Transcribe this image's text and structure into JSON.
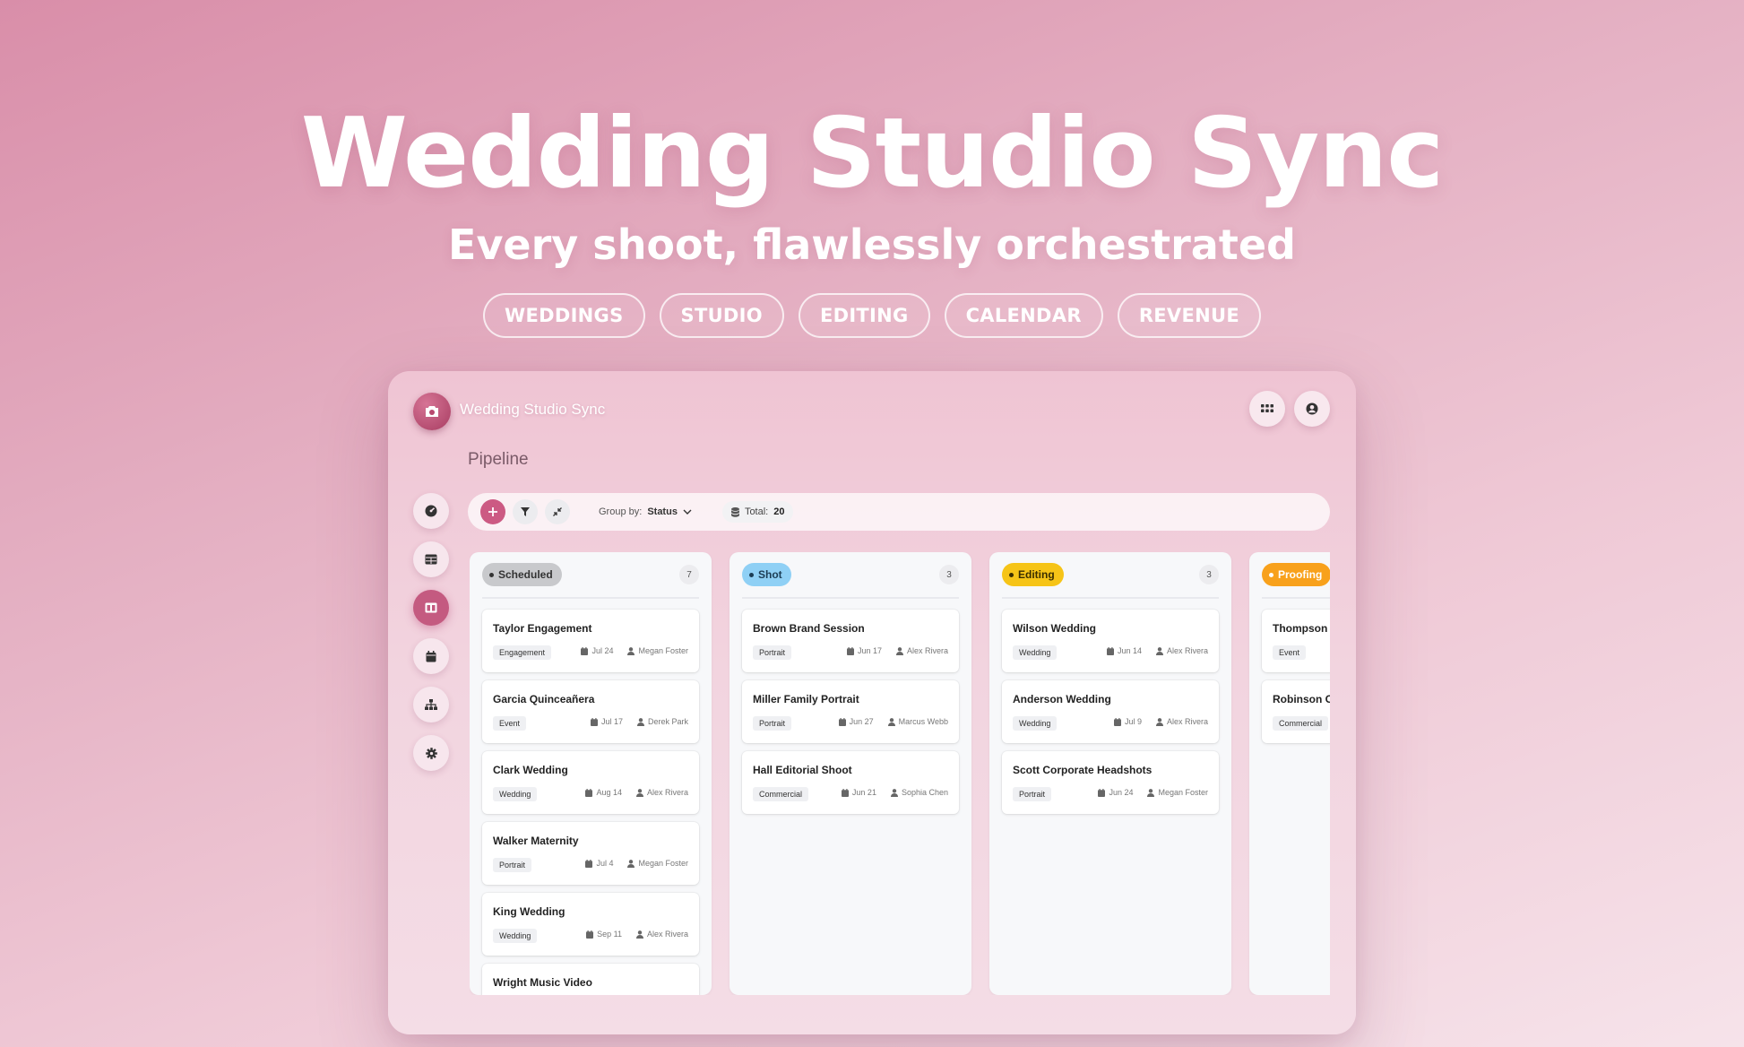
{
  "hero": {
    "title": "Wedding Studio Sync",
    "subtitle": "Every shoot, flawlessly orchestrated",
    "tags": [
      "WEDDINGS",
      "STUDIO",
      "EDITING",
      "CALENDAR",
      "REVENUE"
    ]
  },
  "app": {
    "name": "Wedding Studio Sync",
    "page_title": "Pipeline",
    "accent": "#c45a80",
    "sidebar_icons": [
      "dashboard-icon",
      "table-icon",
      "board-icon",
      "calendar-icon",
      "org-chart-icon",
      "settings-icon"
    ],
    "toolbar": {
      "group_by_label": "Group by:",
      "group_by_value": "Status",
      "total_label": "Total:",
      "total_value": "20"
    },
    "columns": [
      {
        "label": "Scheduled",
        "count": "7",
        "pill_bg": "#c8c9cc",
        "pill_fg": "#333333",
        "dot": "#333333",
        "cards": [
          {
            "title": "Taylor Engagement",
            "type": "Engagement",
            "date": "Jul 24",
            "person": "Megan Foster"
          },
          {
            "title": "Garcia Quinceañera",
            "type": "Event",
            "date": "Jul 17",
            "person": "Derek Park"
          },
          {
            "title": "Clark Wedding",
            "type": "Wedding",
            "date": "Aug 14",
            "person": "Alex Rivera"
          },
          {
            "title": "Walker Maternity",
            "type": "Portrait",
            "date": "Jul 4",
            "person": "Megan Foster"
          },
          {
            "title": "King Wedding",
            "type": "Wedding",
            "date": "Sep 11",
            "person": "Alex Rivera"
          },
          {
            "title": "Wright Music Video",
            "type": "",
            "date": "",
            "person": ""
          }
        ]
      },
      {
        "label": "Shot",
        "count": "3",
        "pill_bg": "#8fd0f5",
        "pill_fg": "#1c3d55",
        "dot": "#1c3d55",
        "cards": [
          {
            "title": "Brown Brand Session",
            "type": "Portrait",
            "date": "Jun 17",
            "person": "Alex Rivera"
          },
          {
            "title": "Miller Family Portrait",
            "type": "Portrait",
            "date": "Jun 27",
            "person": "Marcus Webb"
          },
          {
            "title": "Hall Editorial Shoot",
            "type": "Commercial",
            "date": "Jun 21",
            "person": "Sophia Chen"
          }
        ]
      },
      {
        "label": "Editing",
        "count": "3",
        "pill_bg": "#f6c417",
        "pill_fg": "#3a2e00",
        "dot": "#3a2e00",
        "cards": [
          {
            "title": "Wilson Wedding",
            "type": "Wedding",
            "date": "Jun 14",
            "person": "Alex Rivera"
          },
          {
            "title": "Anderson Wedding",
            "type": "Wedding",
            "date": "Jul 9",
            "person": "Alex Rivera"
          },
          {
            "title": "Scott Corporate Headshots",
            "type": "Portrait",
            "date": "Jun 24",
            "person": "Megan Foster"
          }
        ]
      },
      {
        "label": "Proofing",
        "count": "",
        "pill_bg": "#f8a11c",
        "pill_fg": "#ffffff",
        "dot": "#ffffff",
        "cards": [
          {
            "title": "Thompson C",
            "type": "Event",
            "date": "",
            "person": ""
          },
          {
            "title": "Robinson Co",
            "type": "Commercial",
            "date": "",
            "person": ""
          }
        ]
      }
    ]
  }
}
